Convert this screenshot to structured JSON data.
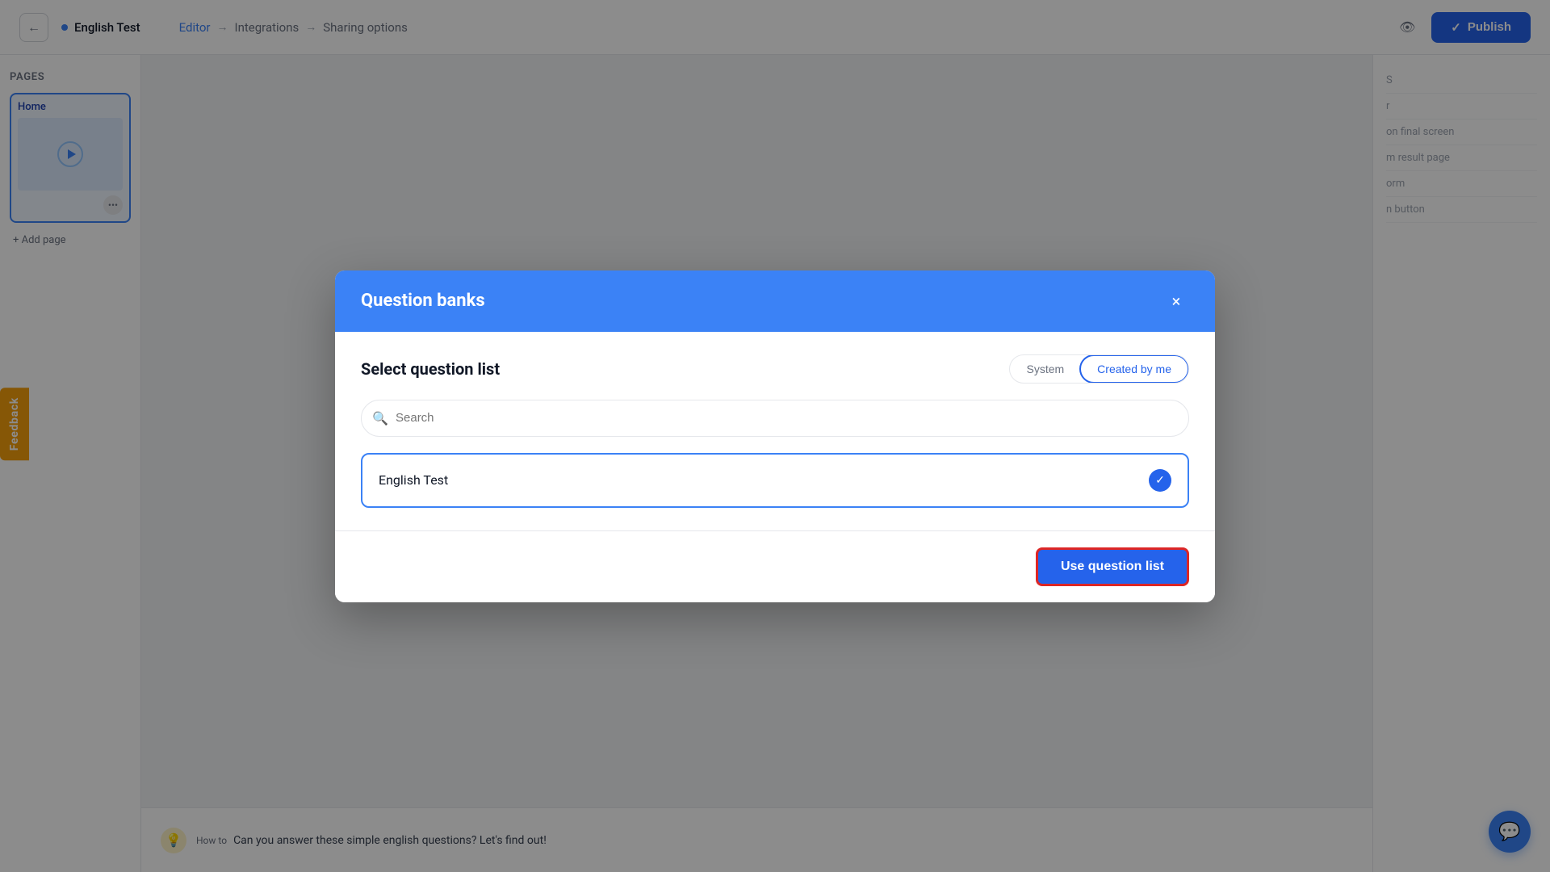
{
  "topNav": {
    "backButtonLabel": "←",
    "docTitle": "English Test",
    "dotColor": "#3b82f6",
    "steps": [
      {
        "label": "Editor",
        "active": true
      },
      {
        "label": "Integrations",
        "active": false
      },
      {
        "label": "Sharing options",
        "active": false
      }
    ],
    "eyeIconLabel": "👁",
    "publishLabel": "Publish",
    "publishCheckmark": "✓"
  },
  "sidebar": {
    "pagesTitle": "Pages",
    "pages": [
      {
        "label": "Home"
      }
    ],
    "addPageLabel": "+ Add page"
  },
  "rightPanel": {
    "items": [
      "S",
      "r",
      "on final screen",
      "m result page",
      "orm",
      "n button"
    ]
  },
  "feedback": {
    "label": "Feedback"
  },
  "footer": {
    "howToLabel": "How to",
    "text": "Can you answer these simple english questions? Let's find out!"
  },
  "modal": {
    "title": "Question banks",
    "closeLabel": "×",
    "bodyTitle": "Select question list",
    "tabs": [
      {
        "label": "System",
        "active": false
      },
      {
        "label": "Created by me",
        "active": true
      }
    ],
    "searchPlaceholder": "Search",
    "items": [
      {
        "label": "English Test",
        "selected": true
      }
    ],
    "footer": {
      "useButtonLabel": "Use question list"
    }
  },
  "chat": {
    "iconLabel": "💬"
  }
}
